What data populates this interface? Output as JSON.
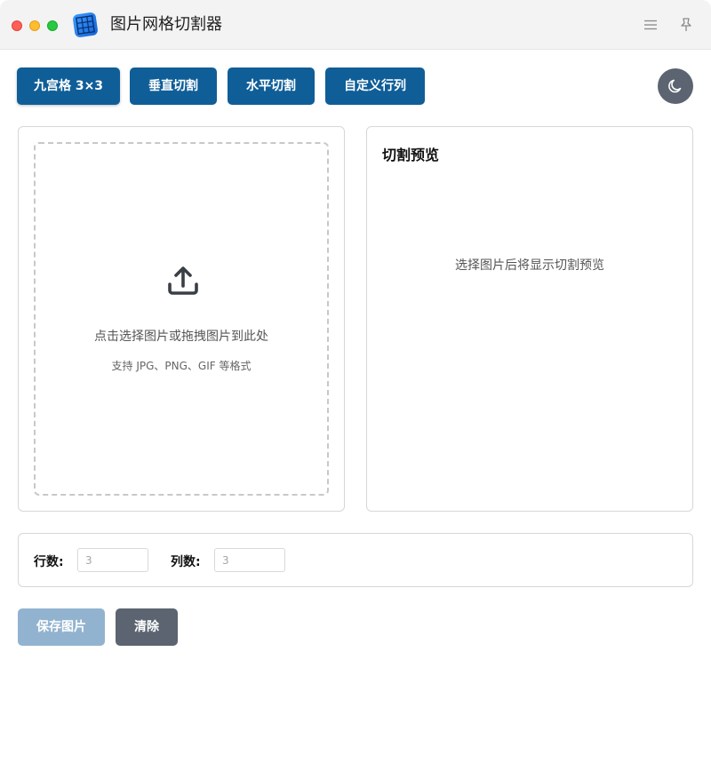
{
  "window": {
    "title": "图片网格切割器"
  },
  "toolbar": {
    "modes": [
      {
        "label": "九宫格 3×3",
        "active": true
      },
      {
        "label": "垂直切割",
        "active": false
      },
      {
        "label": "水平切割",
        "active": false
      },
      {
        "label": "自定义行列",
        "active": false
      }
    ],
    "theme_icon": "moon-icon"
  },
  "upload": {
    "icon": "upload-icon",
    "prompt": "点击选择图片或拖拽图片到此处",
    "formats": "支持 JPG、PNG、GIF 等格式"
  },
  "preview": {
    "title": "切割预览",
    "empty_text": "选择图片后将显示切割预览"
  },
  "settings": {
    "rows_label": "行数:",
    "rows_placeholder": "3",
    "cols_label": "列数:",
    "cols_placeholder": "3"
  },
  "actions": {
    "save_label": "保存图片",
    "clear_label": "清除"
  },
  "colors": {
    "primary": "#0f5e98",
    "primary_disabled": "#92b3cf",
    "secondary": "#5b6470"
  }
}
